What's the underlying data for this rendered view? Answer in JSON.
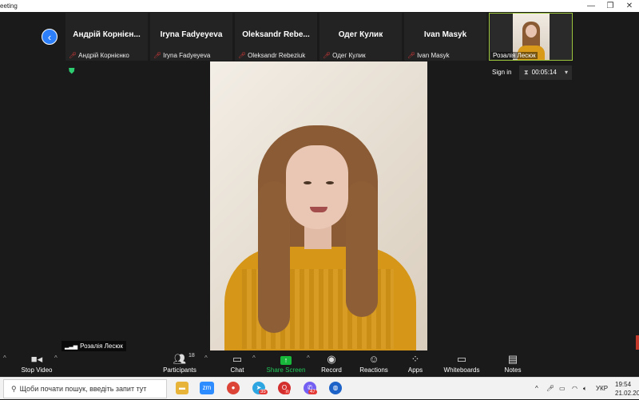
{
  "window": {
    "title": "eeting",
    "controls": {
      "minimize": "—",
      "restore": "❐",
      "close": "✕"
    }
  },
  "top": {
    "back_icon": "‹",
    "thumbnails": [
      {
        "big": "Андрій Корнієн...",
        "small": "Андрій Корнієнко"
      },
      {
        "big": "Iryna Fadyeyeva",
        "small": "Iryna Fadyeyeva"
      },
      {
        "big": "Oleksandr Rebe...",
        "small": "Oleksandr Rebeziuk"
      },
      {
        "big": "Одег Кулик",
        "small": "Одег Кулик"
      },
      {
        "big": "Ivan Masyk",
        "small": "Ivan Masyk"
      }
    ],
    "self_label": "Розалія Лесюк",
    "sign_in": "Sign in",
    "timer": "00:05:14"
  },
  "speaker": {
    "name": "Розалія Лесюк"
  },
  "toolbar": {
    "stop_video": "Stop Video",
    "participants": "Participants",
    "participants_count": "18",
    "chat": "Chat",
    "share_screen": "Share Screen",
    "record": "Record",
    "reactions": "Reactions",
    "apps": "Apps",
    "whiteboards": "Whiteboards",
    "notes": "Notes"
  },
  "taskbar": {
    "search_placeholder": "Щоби почати пошук, введіть запит тут",
    "zoom_label": "zm",
    "telegram_badge": "35",
    "opera_badge": "п",
    "viber_badge": "47",
    "language": "УКР",
    "time": "19:54",
    "date": "21.02.20"
  },
  "colors": {
    "accent_blue": "#2d7ff9",
    "share_green": "#21c95a",
    "muted_red": "#e03a3a",
    "active_border": "#9bc43a"
  }
}
